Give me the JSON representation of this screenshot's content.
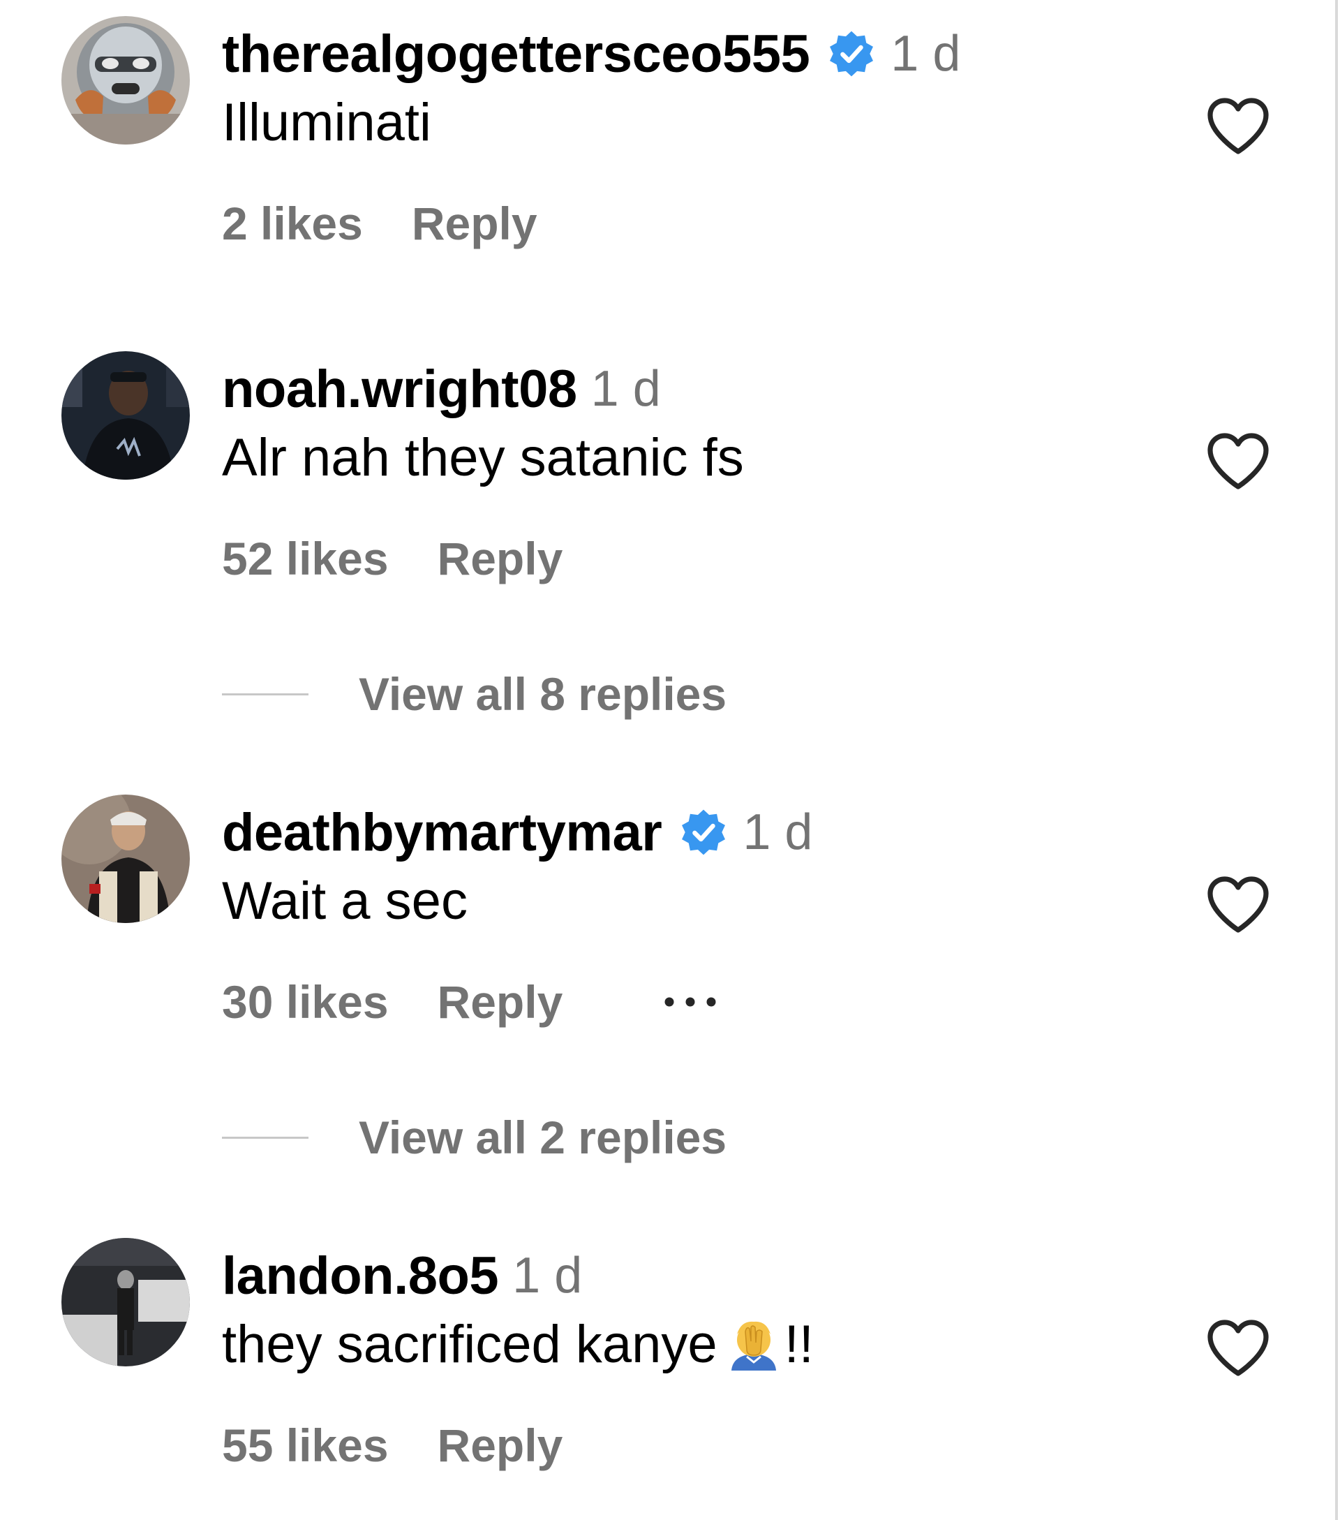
{
  "comments": [
    {
      "username": "therealgogettersceo555",
      "verified": true,
      "time": "1 d",
      "text": "Illuminati",
      "likes": "2 likes",
      "reply": "Reply"
    },
    {
      "username": "noah.wright08",
      "verified": false,
      "time": "1 d",
      "text": "Alr nah they satanic fs",
      "likes": "52 likes",
      "reply": "Reply",
      "view_replies": "View all 8 replies"
    },
    {
      "username": "deathbymartymar",
      "verified": true,
      "time": "1 d",
      "text": "Wait a sec",
      "likes": "30 likes",
      "reply": "Reply",
      "more_icon": "more-options-icon",
      "view_replies": "View all 2 replies"
    },
    {
      "username": "landon.8o5",
      "verified": false,
      "time": "1 d",
      "text": "they sacrificed kanye",
      "text_suffix": "!!",
      "emoji": "face-palm-emoji",
      "likes": "55 likes",
      "reply": "Reply"
    }
  ],
  "icons": {
    "like": "heart-icon",
    "verified": "verified-badge-icon"
  },
  "colors": {
    "verified_blue": "#3897f0",
    "secondary_text": "#737373",
    "primary_text": "#000000"
  }
}
